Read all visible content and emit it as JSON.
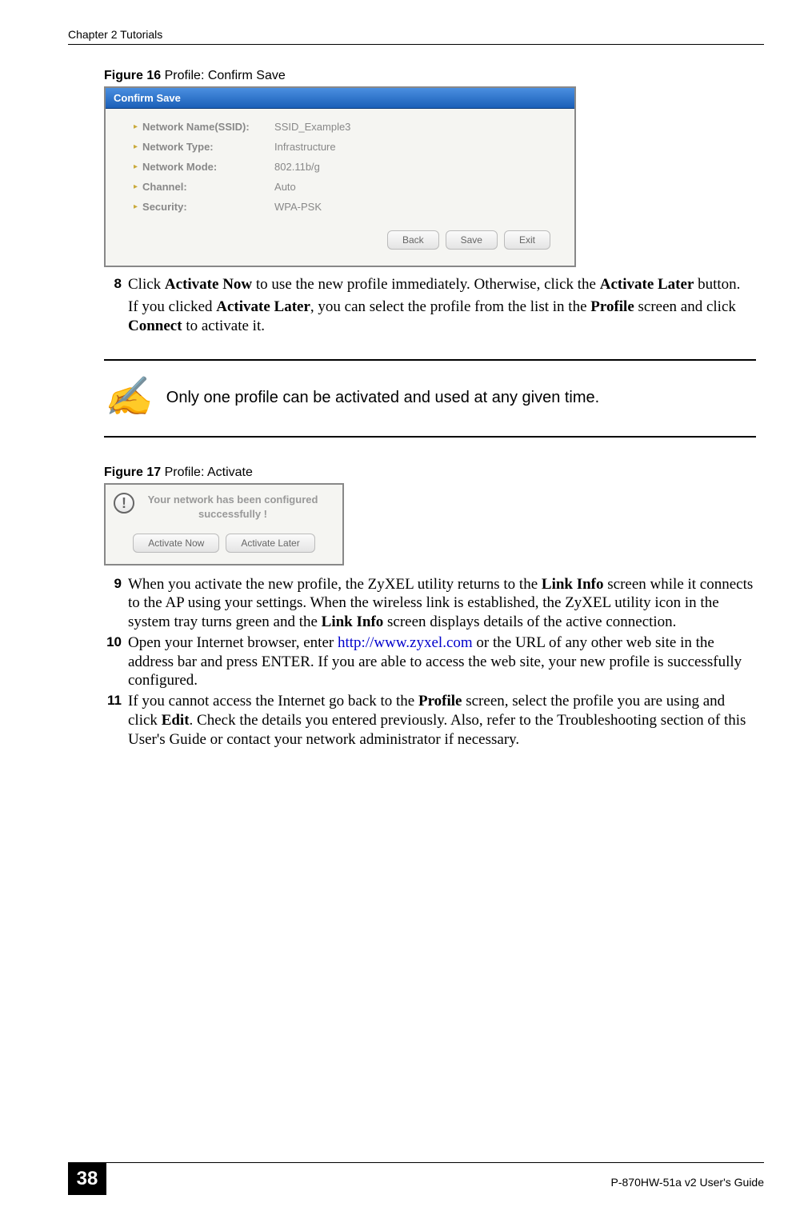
{
  "header": {
    "chapter": "Chapter 2 Tutorials"
  },
  "figure16": {
    "label": "Figure 16",
    "title": "   Profile: Confirm Save",
    "dialog_title": "Confirm Save",
    "rows": [
      {
        "label": "Network Name(SSID):",
        "value": "SSID_Example3"
      },
      {
        "label": "Network Type:",
        "value": "Infrastructure"
      },
      {
        "label": "Network Mode:",
        "value": "802.11b/g"
      },
      {
        "label": "Channel:",
        "value": "Auto"
      },
      {
        "label": "Security:",
        "value": "WPA-PSK"
      }
    ],
    "buttons": {
      "back": "Back",
      "save": "Save",
      "exit": "Exit"
    }
  },
  "step8": {
    "num": "8",
    "text_a": "Click ",
    "bold_a": "Activate Now",
    "text_b": " to use the new profile immediately. Otherwise, click the ",
    "bold_b": "Activate Later",
    "text_c": " button.",
    "sub_a": "If you clicked ",
    "sub_bold_a": "Activate Later",
    "sub_b": ", you can select the profile from the list in the ",
    "sub_bold_b": "Profile",
    "sub_c": " screen and click ",
    "sub_bold_c": "Connect",
    "sub_d": " to activate it."
  },
  "note": {
    "text": "Only one profile can be activated and used at any given time."
  },
  "figure17": {
    "label": "Figure 17",
    "title": "   Profile: Activate",
    "message_line1": "Your network has been configured",
    "message_line2": "successfully !",
    "buttons": {
      "now": "Activate Now",
      "later": "Activate Later"
    }
  },
  "step9": {
    "num": "9",
    "a": "When you activate the new profile, the ZyXEL utility returns to the ",
    "b1": "Link Info",
    "b": " screen while it connects to the AP using your settings. When the wireless link is established, the ZyXEL utility icon in the system tray turns green and the ",
    "b2": "Link Info",
    "c": " screen displays details of the active connection."
  },
  "step10": {
    "num": "10",
    "a": "Open your Internet browser, enter ",
    "link": "http://www.zyxel.com",
    "b": " or the URL of any other web site in the address bar and press ENTER. If you are able to access the web site, your new profile is successfully configured."
  },
  "step11": {
    "num": "11",
    "a": "If you cannot access the Internet go back to the ",
    "b1": "Profile",
    "b": " screen, select the profile you are using and click ",
    "b2": "Edit",
    "c": ". Check the details you entered previously. Also, refer to the Troubleshooting section of this User's Guide or contact your network administrator if necessary."
  },
  "footer": {
    "page": "38",
    "guide": "P-870HW-51a v2 User's Guide"
  }
}
